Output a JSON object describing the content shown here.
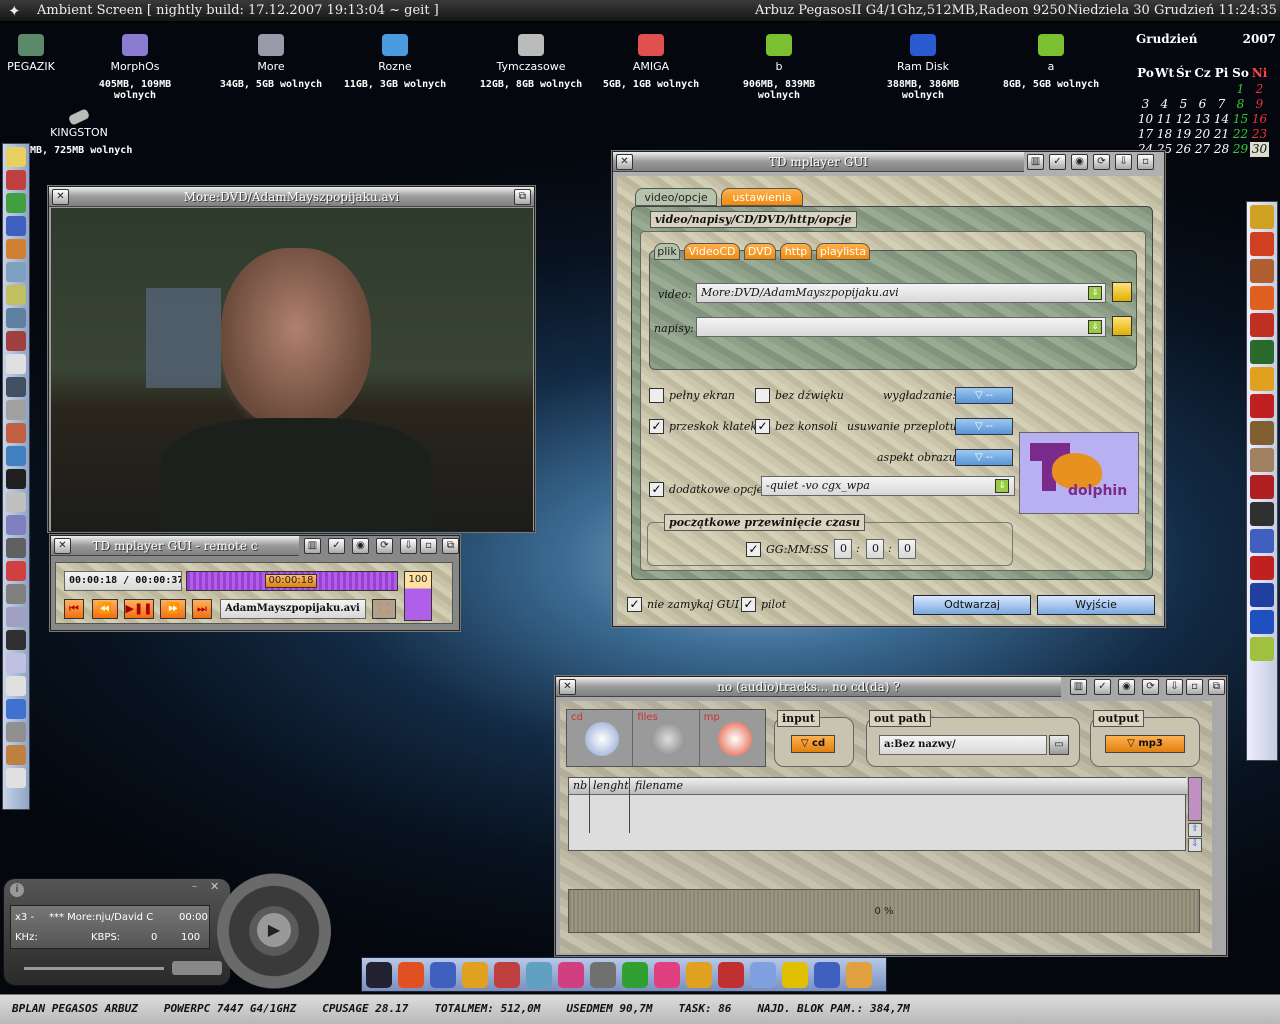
{
  "topbar": {
    "left": "Ambient Screen  [ nightly build: 17.12.2007 19:13:04 ~ geit ]",
    "machine": "Arbuz PegasosII G4/1Ghz,512MB,Radeon 9250",
    "datetime": "Niedziela 30 Grudzień 11:24:35"
  },
  "desktop_icons": [
    {
      "name": "PEGAZIK",
      "free": "",
      "color": "#5a8a6a"
    },
    {
      "name": "MorphOs",
      "free": "405MB, 109MB wolnych",
      "color": "#8a7ad0"
    },
    {
      "name": "More",
      "free": "34GB, 5GB wolnych",
      "color": "#9a9aaa"
    },
    {
      "name": "Rozne",
      "free": "11GB, 3GB wolnych",
      "color": "#4a9ae0"
    },
    {
      "name": "Tymczasowe",
      "free": "12GB, 8GB wolnych",
      "color": "#bbbbbb"
    },
    {
      "name": "AMIGA",
      "free": "5GB, 1GB wolnych",
      "color": "#e05050"
    },
    {
      "name": "b",
      "free": "906MB, 839MB wolnych",
      "color": "#7ac030"
    },
    {
      "name": "Ram Disk",
      "free": "388MB, 386MB wolnych",
      "color": "#2a5ad0"
    },
    {
      "name": "a",
      "free": "8GB, 5GB wolnych",
      "color": "#7ac030"
    }
  ],
  "kingston": {
    "name": "KINGSTON",
    "free": "MB, 725MB wolnych"
  },
  "calendar": {
    "month": "Grudzień",
    "year": "2007",
    "days": [
      "Po",
      "Wt",
      "Śr",
      "Cz",
      "Pi",
      "So",
      "Ni"
    ],
    "rows": [
      [
        "",
        "",
        "",
        "",
        "",
        "1",
        "2"
      ],
      [
        "3",
        "4",
        "5",
        "6",
        "7",
        "8",
        "9"
      ],
      [
        "10",
        "11",
        "12",
        "13",
        "14",
        "15",
        "16"
      ],
      [
        "17",
        "18",
        "19",
        "20",
        "21",
        "22",
        "23"
      ],
      [
        "24",
        "25",
        "26",
        "27",
        "28",
        "29",
        "30"
      ]
    ]
  },
  "video_window": {
    "title": "More:DVD/AdamMayszpopijaku.avi"
  },
  "remote": {
    "title": "TD mplayer GUI - remote c",
    "time": "00:00:18 / 00:00:37",
    "position": "00:00:18",
    "volume": "100",
    "file": "AdamMayszpopijaku.avi",
    "progress_fraction": 0.49
  },
  "mplayer": {
    "title": "TD mplayer GUI",
    "tabs": [
      "video/opcje",
      "ustawienia"
    ],
    "group_title": "video/napisy/CD/DVD/http/opcje",
    "subtabs": [
      "plik",
      "VideoCD",
      "DVD",
      "http",
      "playlista"
    ],
    "video_label": "video:",
    "video_value": "More:DVD/AdamMayszpopijaku.avi",
    "subs_label": "napisy:",
    "subs_value": "",
    "fullscreen": "pełny ekran",
    "nosound": "bez dźwięku",
    "smoothing": "wygładzanie:",
    "frameskip": "przeskok klatek",
    "noconsole": "bez konsoli",
    "deinterlace": "usuwanie przeplotu:",
    "aspect": "aspekt obrazu:",
    "popup_value": "--",
    "extra_label": "dodatkowe opcje:",
    "extra_value": "-quiet -vo cgx_wpa",
    "seek_group": "początkowe przewinięcie czasu",
    "time_label": "GG:MM:SS",
    "hh": "0",
    "mm": "0",
    "ss": "0",
    "keep_gui": "nie zamykaj GUI",
    "pilot": "pilot",
    "play": "Odtwarzaj",
    "exit": "Wyjście",
    "logo": "dolphin"
  },
  "cdwin": {
    "title": "no (audio)tracks... no cd(da) ?",
    "icon_labels": [
      "cd",
      "files",
      "mp"
    ],
    "input_label": "input",
    "input_value": "cd",
    "outpath_label": "out path",
    "outpath_value": "a:Bez nazwy/",
    "output_label": "output",
    "output_value": "mp3",
    "columns": [
      "nb",
      "lenght",
      "filename"
    ],
    "progress": "0 %"
  },
  "amp": {
    "line1a": "x3 -",
    "line1b": "*** More:nju/David C",
    "line1c": "00:00",
    "khz": "KHz:",
    "kbps": "KBPS:",
    "val1": "0",
    "val2": "100"
  },
  "status": [
    "BPLAN PEGASOS ARBUZ",
    "POWERPC 7447 G4/1GHZ",
    "CPUSAGE 28.17",
    "TOTALMEM: 512,0M",
    "USEDMEM 90,7M",
    "TASK: 86",
    "NAJD. BLOK PAM.: 384,7M"
  ]
}
